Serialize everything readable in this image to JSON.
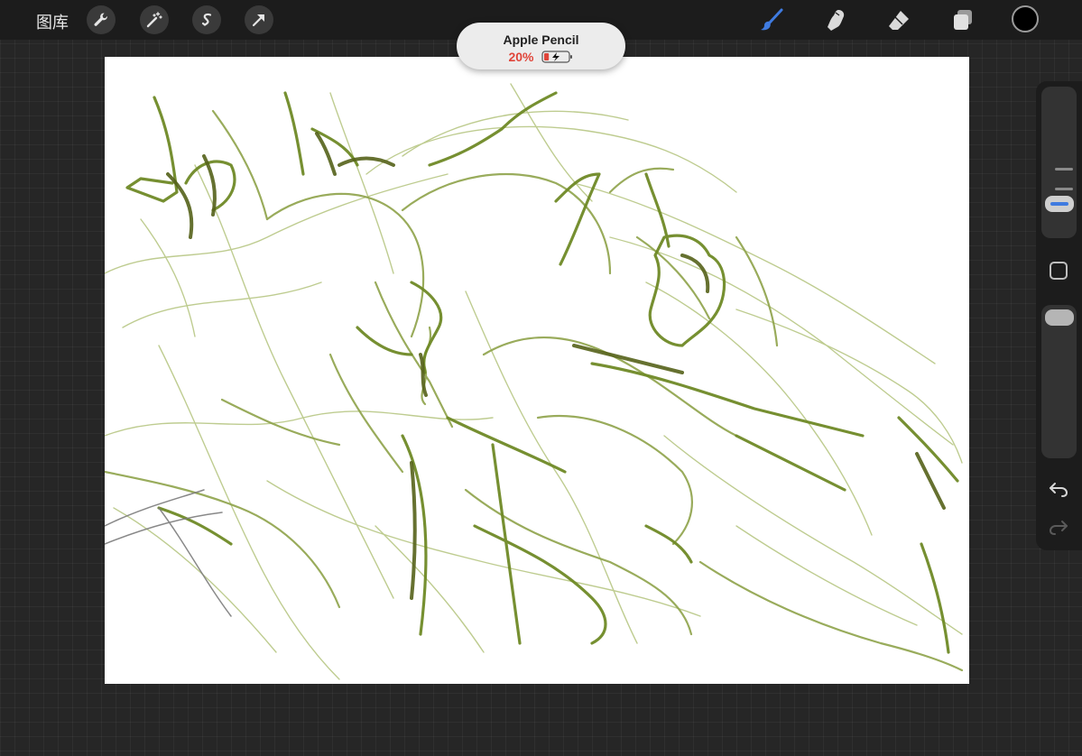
{
  "topbar": {
    "gallery_label": "图库",
    "actions_icon": "wrench-icon",
    "adjustments_icon": "magic-wand-icon",
    "selection_icon": "selection-s-icon",
    "transform_icon": "arrow-cursor-icon",
    "brush_icon": "brush-icon",
    "smudge_icon": "smudge-finger-icon",
    "eraser_icon": "eraser-icon",
    "layers_icon": "layers-icon",
    "active_tool": "brush",
    "accent_color": "#3f7be0",
    "current_color": "#000000"
  },
  "pencil_status": {
    "title": "Apple Pencil",
    "battery": "20%",
    "battery_level": 0.2,
    "battery_color": "#e0453a"
  },
  "sidebar": {
    "brush_size_level": 0.28,
    "opacity_level": 0.05,
    "modify_icon": "square-modify-icon",
    "undo_icon": "undo-arrow-icon",
    "redo_icon": "redo-arrow-icon"
  },
  "canvas": {
    "background": "#ffffff",
    "stroke_colors": [
      "#6f8a26",
      "#8ea34a",
      "#b2c27a",
      "#55621a"
    ]
  }
}
